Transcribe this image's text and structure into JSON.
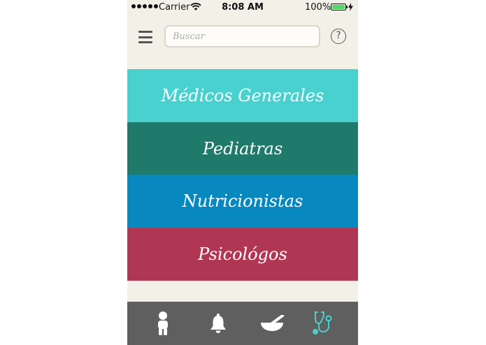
{
  "status_bar": {
    "carrier": "Carrier",
    "time": "8:08 AM",
    "battery": "100%"
  },
  "header": {
    "search_placeholder": "Buscar",
    "help_label": "?"
  },
  "categories": [
    {
      "label": "Médicos Generales",
      "color": "#48d1cf"
    },
    {
      "label": "Pediatras",
      "color": "#1f7a6b"
    },
    {
      "label": "Nutricionistas",
      "color": "#0788bf"
    },
    {
      "label": "Psicológos",
      "color": "#b03753"
    }
  ],
  "tab_bar": {
    "active_color": "#48d1cf",
    "tabs": [
      {
        "icon": "child-icon",
        "active": false
      },
      {
        "icon": "bell-icon",
        "active": false
      },
      {
        "icon": "mortar-pestle-icon",
        "active": false
      },
      {
        "icon": "stethoscope-icon",
        "active": true
      }
    ]
  }
}
